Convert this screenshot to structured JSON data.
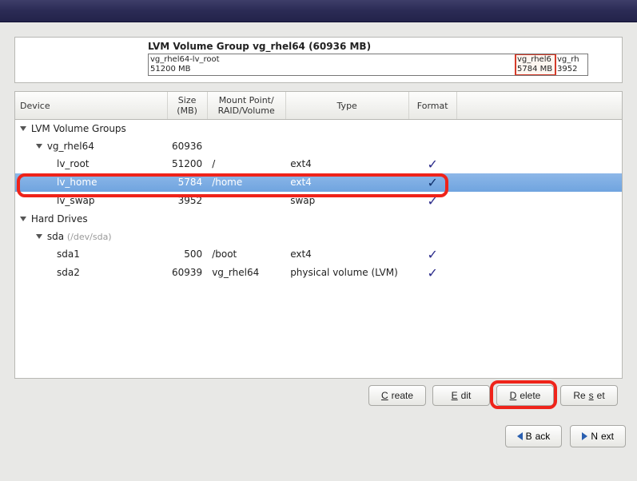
{
  "vg_panel": {
    "title": "LVM Volume Group vg_rhel64 (60936 MB)",
    "slices": {
      "root": {
        "label": "vg_rhel64-lv_root",
        "size": "51200 MB"
      },
      "home": {
        "label": "vg_rhel6",
        "size": "5784 MB"
      },
      "swap": {
        "label": "vg_rh",
        "size": "3952"
      }
    }
  },
  "columns": {
    "device": "Device",
    "size": "Size\n(MB)",
    "mount": "Mount Point/\nRAID/Volume",
    "type": "Type",
    "format": "Format"
  },
  "groups": {
    "lvm_header": "LVM Volume Groups",
    "hd_header": "Hard Drives"
  },
  "rows": {
    "vg": {
      "device": "vg_rhel64",
      "size": "60936",
      "mount": "",
      "type": "",
      "format": false
    },
    "lv_root": {
      "device": "lv_root",
      "size": "51200",
      "mount": "/",
      "type": "ext4",
      "format": true
    },
    "lv_home": {
      "device": "lv_home",
      "size": "5784",
      "mount": "/home",
      "type": "ext4",
      "format": true
    },
    "lv_swap": {
      "device": "lv_swap",
      "size": "3952",
      "mount": "",
      "type": "swap",
      "format": true
    },
    "sda": {
      "device": "sda",
      "hint": "(/dev/sda)",
      "size": "",
      "mount": "",
      "type": "",
      "format": false
    },
    "sda1": {
      "device": "sda1",
      "size": "500",
      "mount": "/boot",
      "type": "ext4",
      "format": true
    },
    "sda2": {
      "device": "sda2",
      "size": "60939",
      "mount": "vg_rhel64",
      "type": "physical volume (LVM)",
      "format": true
    }
  },
  "buttons": {
    "create": "Create",
    "edit": "Edit",
    "delete": "Delete",
    "reset": "Reset",
    "back": "Back",
    "next": "Next"
  }
}
